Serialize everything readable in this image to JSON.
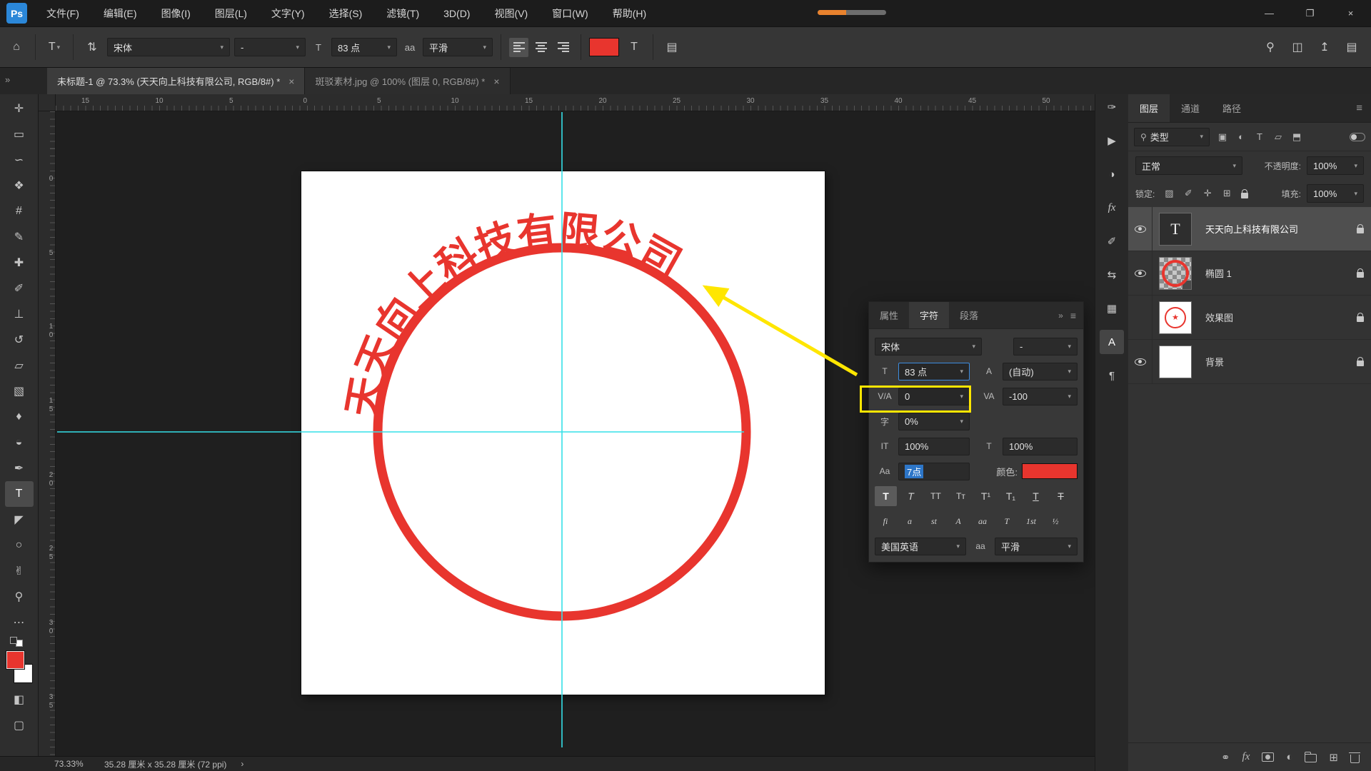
{
  "ui": {
    "chevron": "▾"
  },
  "colors": {
    "accent_red": "#e8352e",
    "guide_cyan": "#35e0e8",
    "highlight_yellow": "#ffe600",
    "selection_blue": "#2d76c8"
  },
  "app": {
    "logo": "Ps"
  },
  "menu": {
    "items": [
      "文件(F)",
      "编辑(E)",
      "图像(I)",
      "图层(L)",
      "文字(Y)",
      "选择(S)",
      "滤镜(T)",
      "3D(D)",
      "视图(V)",
      "窗口(W)",
      "帮助(H)"
    ]
  },
  "window_controls": {
    "minimize": "—",
    "restore": "❐",
    "close": "×"
  },
  "options_bar": {
    "home_icon": "⌂",
    "tool_preset_icon": "T",
    "orientation_icon": "⇅",
    "font_family": "宋体",
    "font_style": "-",
    "size_icon": "T",
    "font_size": "83 点",
    "antialias_icon": "aa",
    "antialias": "平滑",
    "align": [
      {
        "name": "align-left",
        "active": true
      },
      {
        "name": "align-center",
        "active": false
      },
      {
        "name": "align-right",
        "active": false
      }
    ],
    "warp_icon": "T",
    "panel_icon": "▤",
    "right_icons": [
      {
        "name": "search-icon",
        "glyph": "⚲"
      },
      {
        "name": "arrange-documents-icon",
        "glyph": "◫"
      },
      {
        "name": "share-icon",
        "glyph": "↥"
      },
      {
        "name": "workspace-icon",
        "glyph": "▤"
      }
    ]
  },
  "tabs": [
    {
      "title": "未标题-1 @ 73.3% (天天向上科技有限公司, RGB/8#) *",
      "close": "×",
      "active": true
    },
    {
      "title": "斑驳素材.jpg @ 100% (图层 0, RGB/8#) *",
      "close": "×",
      "active": false
    }
  ],
  "toolbar": {
    "collapse_icon": "»",
    "tools": [
      {
        "name": "move-tool",
        "glyph": "✛",
        "active": false
      },
      {
        "name": "marquee-tool",
        "glyph": "▭",
        "active": false
      },
      {
        "name": "lasso-tool",
        "glyph": "∽",
        "active": false
      },
      {
        "name": "quick-selection-tool",
        "glyph": "❖",
        "active": false
      },
      {
        "name": "crop-tool",
        "glyph": "#",
        "active": false
      },
      {
        "name": "eyedropper-tool",
        "glyph": "✎",
        "active": false
      },
      {
        "name": "healing-brush-tool",
        "glyph": "✚",
        "active": false
      },
      {
        "name": "brush-tool",
        "glyph": "✐",
        "active": false
      },
      {
        "name": "clone-stamp-tool",
        "glyph": "⊥",
        "active": false
      },
      {
        "name": "history-brush-tool",
        "glyph": "↺",
        "active": false
      },
      {
        "name": "eraser-tool",
        "glyph": "▱",
        "active": false
      },
      {
        "name": "gradient-tool",
        "glyph": "▧",
        "active": false
      },
      {
        "name": "blur-tool",
        "glyph": "♦",
        "active": false
      },
      {
        "name": "dodge-tool",
        "glyph": "◒",
        "active": false
      },
      {
        "name": "pen-tool",
        "glyph": "✒",
        "active": false
      },
      {
        "name": "type-tool",
        "glyph": "T",
        "active": true
      },
      {
        "name": "path-selection-tool",
        "glyph": "◤",
        "active": false
      },
      {
        "name": "ellipse-tool",
        "glyph": "○",
        "active": false
      },
      {
        "name": "hand-tool",
        "glyph": "✌",
        "active": false
      },
      {
        "name": "zoom-tool",
        "glyph": "⚲",
        "active": false
      },
      {
        "name": "edit-toolbar-icon",
        "glyph": "⋯",
        "active": false
      }
    ],
    "quick_mask_icon": "◧",
    "screen_mode_icon": "▢",
    "fg_color": "#e8352e",
    "bg_color": "#ffffff"
  },
  "rulers": {
    "top": [
      "15",
      "10",
      "5",
      "0",
      "5",
      "10",
      "15",
      "20",
      "25",
      "30",
      "35",
      "40",
      "45",
      "50"
    ],
    "left": [
      "0",
      "5",
      "10",
      "15",
      "20",
      "25",
      "30",
      "35"
    ]
  },
  "canvas": {
    "stamp_text": "天天向上科技有限公司"
  },
  "char_panel": {
    "tabs": [
      {
        "label": "属性",
        "active": false
      },
      {
        "label": "字符",
        "active": true
      },
      {
        "label": "段落",
        "active": false
      }
    ],
    "expand_icon": "»",
    "menu_icon": "≡",
    "font_family": "宋体",
    "font_style": "-",
    "size_icon": "T",
    "size": "83 点",
    "leading_icon": "A",
    "leading": "(自动)",
    "kerning_icon": "V/A",
    "kerning": "0",
    "tracking_icon": "VA",
    "tracking": "-100",
    "spacing_icon": "字",
    "spacing": "0%",
    "vscale_icon": "IT",
    "vscale": "100%",
    "hscale_icon": "T",
    "hscale": "100%",
    "baseline_icon": "Aa",
    "baseline": "7点",
    "color_label": "颜色:",
    "style_buttons": [
      {
        "name": "faux-bold",
        "glyph": "T",
        "active": true
      },
      {
        "name": "faux-italic",
        "glyph": "T",
        "active": false
      },
      {
        "name": "all-caps",
        "glyph": "TT",
        "active": false
      },
      {
        "name": "small-caps",
        "glyph": "Tт",
        "active": false
      },
      {
        "name": "superscript",
        "glyph": "T¹",
        "active": false
      },
      {
        "name": "subscript",
        "glyph": "T₁",
        "active": false
      },
      {
        "name": "underline",
        "glyph": "T",
        "active": false
      },
      {
        "name": "strikethrough",
        "glyph": "T",
        "active": false
      }
    ],
    "ot_buttons": [
      {
        "name": "standard-ligatures",
        "glyph": "fi"
      },
      {
        "name": "contextual-alternates",
        "glyph": "ɑ"
      },
      {
        "name": "discretionary-ligatures",
        "glyph": "st"
      },
      {
        "name": "swash",
        "glyph": "A"
      },
      {
        "name": "stylistic-alternates",
        "glyph": "aa"
      },
      {
        "name": "titling-alternates",
        "glyph": "T"
      },
      {
        "name": "ordinals",
        "glyph": "1st"
      },
      {
        "name": "fractions",
        "glyph": "½"
      }
    ],
    "language": "美国英语",
    "aa_icon": "aa",
    "antialias": "平滑"
  },
  "right_strip": {
    "collapse_icon": "«",
    "icons": [
      {
        "name": "brush-settings-panel-icon",
        "glyph": "✑",
        "active": false
      },
      {
        "name": "actions-panel-icon",
        "glyph": "▶",
        "active": false
      },
      {
        "name": "adjustments-panel-icon",
        "glyph": "◑",
        "active": false
      },
      {
        "name": "styles-panel-icon",
        "glyph": "fx",
        "active": false
      },
      {
        "name": "brushes-panel-icon",
        "glyph": "✐",
        "active": false
      },
      {
        "name": "clone-source-panel-icon",
        "glyph": "⇆",
        "active": false
      },
      {
        "name": "patterns-panel-icon",
        "glyph": "▦",
        "active": false
      },
      {
        "name": "character-panel-icon",
        "glyph": "A",
        "active": true
      },
      {
        "name": "paragraph-panel-icon",
        "glyph": "¶",
        "active": false
      }
    ]
  },
  "layers_panel": {
    "tabs": [
      {
        "label": "图层",
        "active": true
      },
      {
        "label": "通道",
        "active": false
      },
      {
        "label": "路径",
        "active": false
      }
    ],
    "menu_icon": "≡",
    "search_icon": "⚲",
    "filter_label": "类型",
    "filter_icons": [
      {
        "name": "filter-pixel-layers-icon",
        "glyph": "▣"
      },
      {
        "name": "filter-adjustment-layers-icon",
        "glyph": "◐"
      },
      {
        "name": "filter-type-layers-icon",
        "glyph": "T"
      },
      {
        "name": "filter-shape-layers-icon",
        "glyph": "▱"
      },
      {
        "name": "filter-smart-objects-icon",
        "glyph": "⬒"
      }
    ],
    "blend_mode": "正常",
    "opacity_label": "不透明度:",
    "opacity": "100%",
    "lock_label": "锁定:",
    "lock_icons": [
      {
        "name": "lock-transparent-icon",
        "glyph": "▨"
      },
      {
        "name": "lock-pixels-icon",
        "glyph": "✐"
      },
      {
        "name": "lock-position-icon",
        "glyph": "✛"
      },
      {
        "name": "lock-artboard-icon",
        "glyph": "⊞"
      }
    ],
    "fill_label": "填充:",
    "fill": "100%",
    "layers": [
      {
        "name": "天天向上科技有限公司",
        "type": "text",
        "thumb": "T",
        "visible": true,
        "selected": true,
        "locked": false
      },
      {
        "name": "椭圆 1",
        "type": "shape",
        "thumb": "",
        "visible": true,
        "selected": false,
        "locked": false
      },
      {
        "name": "效果图",
        "type": "image",
        "thumb": "★",
        "visible": false,
        "selected": false,
        "locked": false
      },
      {
        "name": "背景",
        "type": "background",
        "thumb": "",
        "visible": true,
        "selected": false,
        "locked": true
      }
    ],
    "footer": {
      "link_icon": "⚭",
      "fx_icon": "fx",
      "adjust_icon": "◐",
      "new_icon": "⊞"
    }
  },
  "status_bar": {
    "zoom": "73.33%",
    "doc_info": "35.28 厘米 x 35.28 厘米 (72 ppi)",
    "chevron": "›"
  }
}
